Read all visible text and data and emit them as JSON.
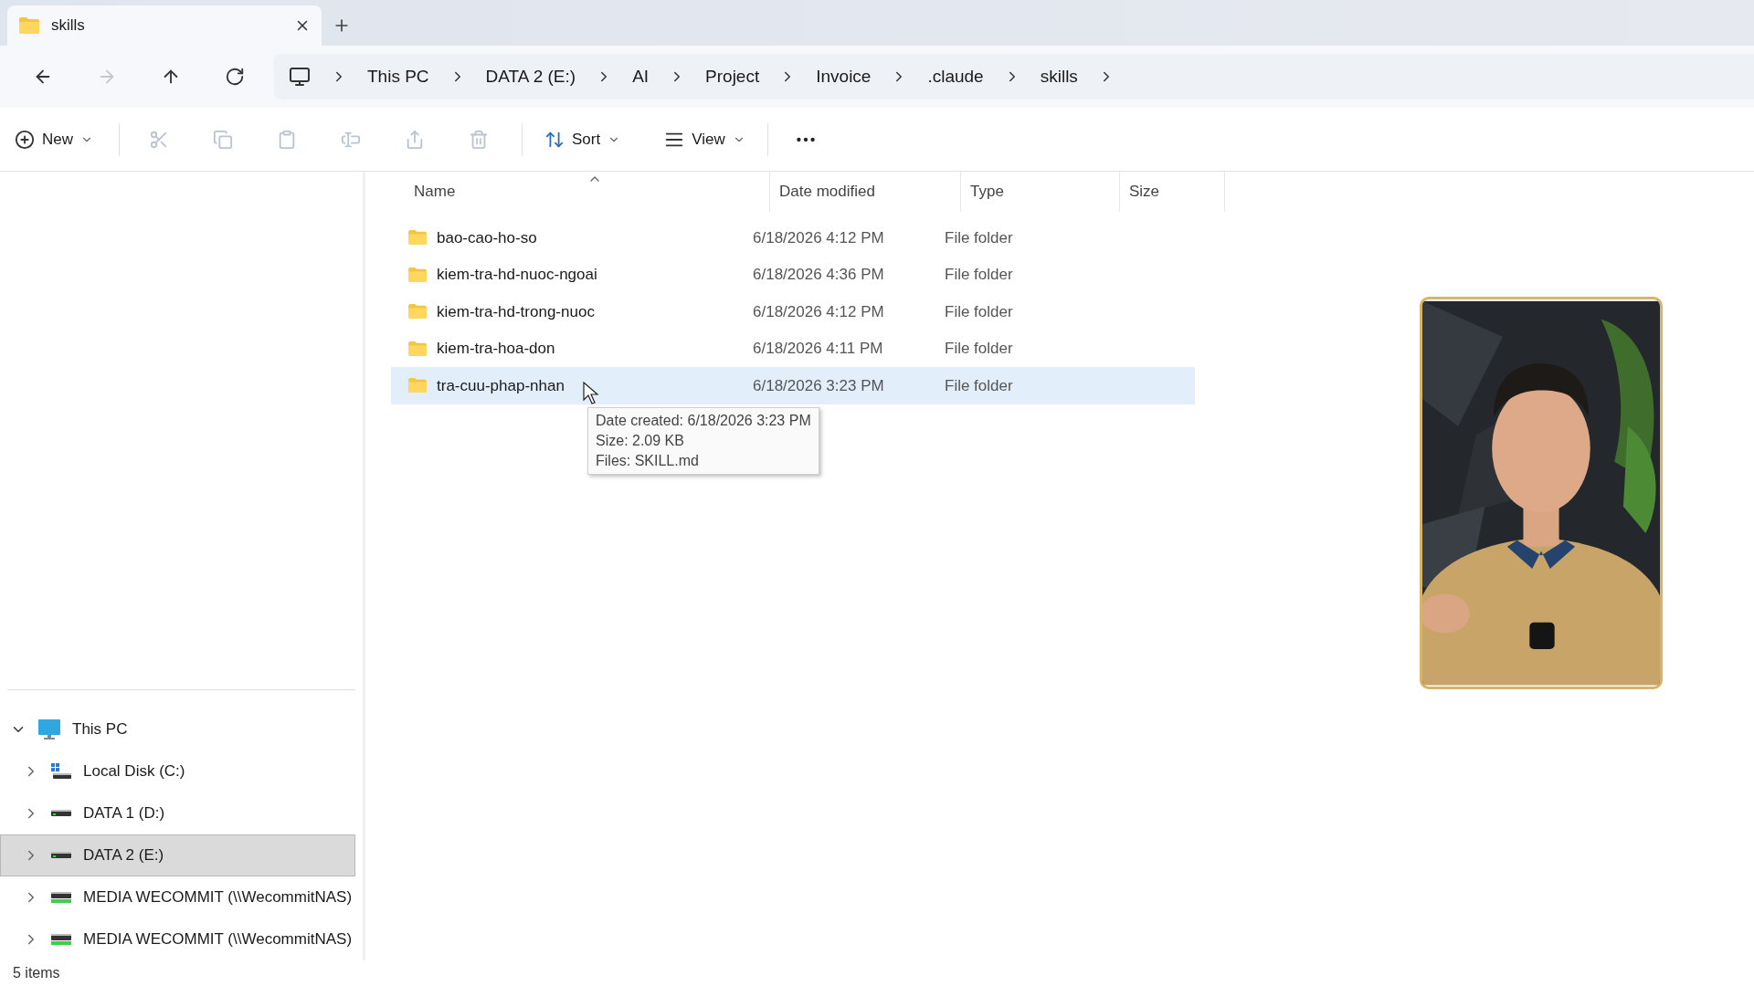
{
  "tab": {
    "title": "skills"
  },
  "nav": [
    {
      "kind": "back",
      "disabled": false
    },
    {
      "kind": "forward",
      "disabled": true
    },
    {
      "kind": "up",
      "disabled": false
    },
    {
      "kind": "refresh",
      "disabled": false
    }
  ],
  "breadcrumb": [
    "This PC",
    "DATA 2 (E:)",
    "AI",
    "Project",
    "Invoice",
    ".claude",
    "skills"
  ],
  "toolbar": {
    "new": {
      "label": "New"
    },
    "actions": [
      {
        "kind": "cut",
        "disabled": true
      },
      {
        "kind": "copy",
        "disabled": true
      },
      {
        "kind": "paste",
        "disabled": true
      },
      {
        "kind": "rename",
        "disabled": true
      },
      {
        "kind": "share",
        "disabled": true
      },
      {
        "kind": "delete",
        "disabled": true
      }
    ],
    "sort": {
      "label": "Sort"
    },
    "view": {
      "label": "View"
    }
  },
  "columns": [
    {
      "label": "Name",
      "sorted": true
    },
    {
      "label": "Date modified",
      "sorted": false
    },
    {
      "label": "Type",
      "sorted": false
    },
    {
      "label": "Size",
      "sorted": false
    }
  ],
  "rows": [
    {
      "name": "bao-cao-ho-so",
      "date": "6/18/2026 4:12 PM",
      "type": "File folder",
      "selected": false
    },
    {
      "name": "kiem-tra-hd-nuoc-ngoai",
      "date": "6/18/2026 4:36 PM",
      "type": "File folder",
      "selected": false
    },
    {
      "name": "kiem-tra-hd-trong-nuoc",
      "date": "6/18/2026 4:12 PM",
      "type": "File folder",
      "selected": false
    },
    {
      "name": "kiem-tra-hoa-don",
      "date": "6/18/2026 4:11 PM",
      "type": "File folder",
      "selected": false
    },
    {
      "name": "tra-cuu-phap-nhan",
      "date": "6/18/2026 3:23 PM",
      "type": "File folder",
      "selected": true
    }
  ],
  "tooltip": [
    "Date created: 6/18/2026 3:23 PM",
    "Size: 2.09 KB",
    "Files: SKILL.md"
  ],
  "tree": [
    {
      "label": "This PC",
      "kind": "pc",
      "expanded": true,
      "selected": false,
      "children": [
        {
          "label": "Local Disk (C:)",
          "kind": "system-drive",
          "expanded": false,
          "selected": false
        },
        {
          "label": "DATA 1 (D:)",
          "kind": "drive",
          "expanded": false,
          "selected": false
        },
        {
          "label": "DATA 2 (E:)",
          "kind": "drive",
          "expanded": false,
          "selected": true
        },
        {
          "label": "MEDIA WECOMMIT (\\\\WecommitNAS)",
          "kind": "network-drive",
          "expanded": false,
          "selected": false
        },
        {
          "label": "MEDIA WECOMMIT (\\\\WecommitNAS)",
          "kind": "network-drive",
          "expanded": false,
          "selected": false
        }
      ]
    }
  ],
  "status_bar": "5 items",
  "webcam": {
    "kind": "picture"
  }
}
